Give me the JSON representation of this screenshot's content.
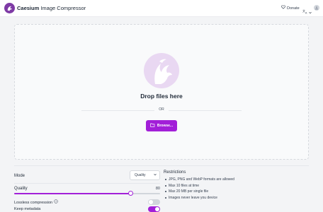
{
  "header": {
    "brand": "Caesium",
    "title_suffix": " Image Compressor",
    "donate_label": "Donate",
    "logo_icon": "caesium-logo-icon",
    "donate_icon": "heart-icon",
    "language_icon": "translate-icon",
    "avatar_icon": "user-avatar-icon"
  },
  "dropzone": {
    "title": "Drop files here",
    "or_text": "OR",
    "browse_label": "Browse...",
    "browse_icon": "folder-open-icon"
  },
  "settings": {
    "mode_label": "Mode",
    "mode_value": "Quality",
    "quality_label": "Quality",
    "quality_value": "80",
    "quality_fraction": 0.8,
    "lossless_label": "Lossless compression",
    "lossless_on": false,
    "metadata_label": "Keep metadata",
    "metadata_on": true
  },
  "restrictions": {
    "title": "Restrictions",
    "items": [
      "JPG, PNG and WebP formats are allowed",
      "Max 10 files at time",
      "Max 20 MB per single file",
      "Images never leave you device"
    ]
  },
  "colors": {
    "accent": "#a21fd8",
    "brand": "#7e3aa5",
    "illustration_bg": "#e9d8f2"
  }
}
